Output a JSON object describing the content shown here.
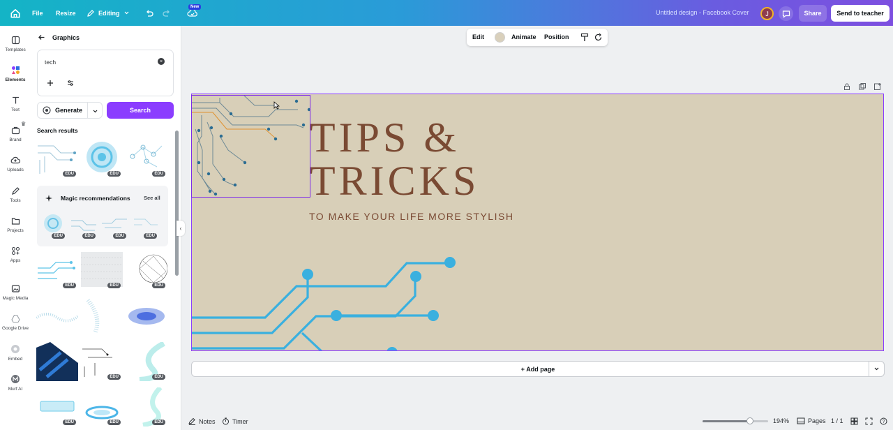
{
  "topbar": {
    "file": "File",
    "resize": "Resize",
    "editing": "Editing",
    "new_badge": "New",
    "doc_title": "Untitled design - Facebook Cover",
    "avatar_initial": "J",
    "share": "Share",
    "send_to_teacher": "Send to teacher"
  },
  "rail": {
    "templates": "Templates",
    "elements": "Elements",
    "text": "Text",
    "brand": "Brand",
    "uploads": "Uploads",
    "tools": "Tools",
    "projects": "Projects",
    "apps": "Apps",
    "magic_media": "Magic Media",
    "google_drive": "Google Drive",
    "embed": "Embed",
    "murf_ai": "Murf AI"
  },
  "panel": {
    "title": "Graphics",
    "search_value": "tech",
    "generate": "Generate",
    "search": "Search",
    "results_title": "Search results",
    "magic_title": "Magic recommendations",
    "see_all": "See all",
    "edu_label": "EDU"
  },
  "context_toolbar": {
    "edit": "Edit",
    "animate": "Animate",
    "position": "Position"
  },
  "canvas": {
    "headline_1": "TIPS &",
    "headline_2": "TRICKS",
    "subline": "TO MAKE YOUR LIFE MORE STYLISH",
    "background_color": "#d8cfb8",
    "text_color": "#7a4a33",
    "circuit_color": "#3ab0df"
  },
  "add_page": "+ Add page",
  "bottombar": {
    "notes": "Notes",
    "timer": "Timer",
    "zoom": "194%",
    "zoom_level": 0.72,
    "pages": "Pages",
    "page_count": "1 / 1"
  },
  "colors": {
    "accent": "#8b3dff",
    "selection": "#7d2ae8"
  }
}
